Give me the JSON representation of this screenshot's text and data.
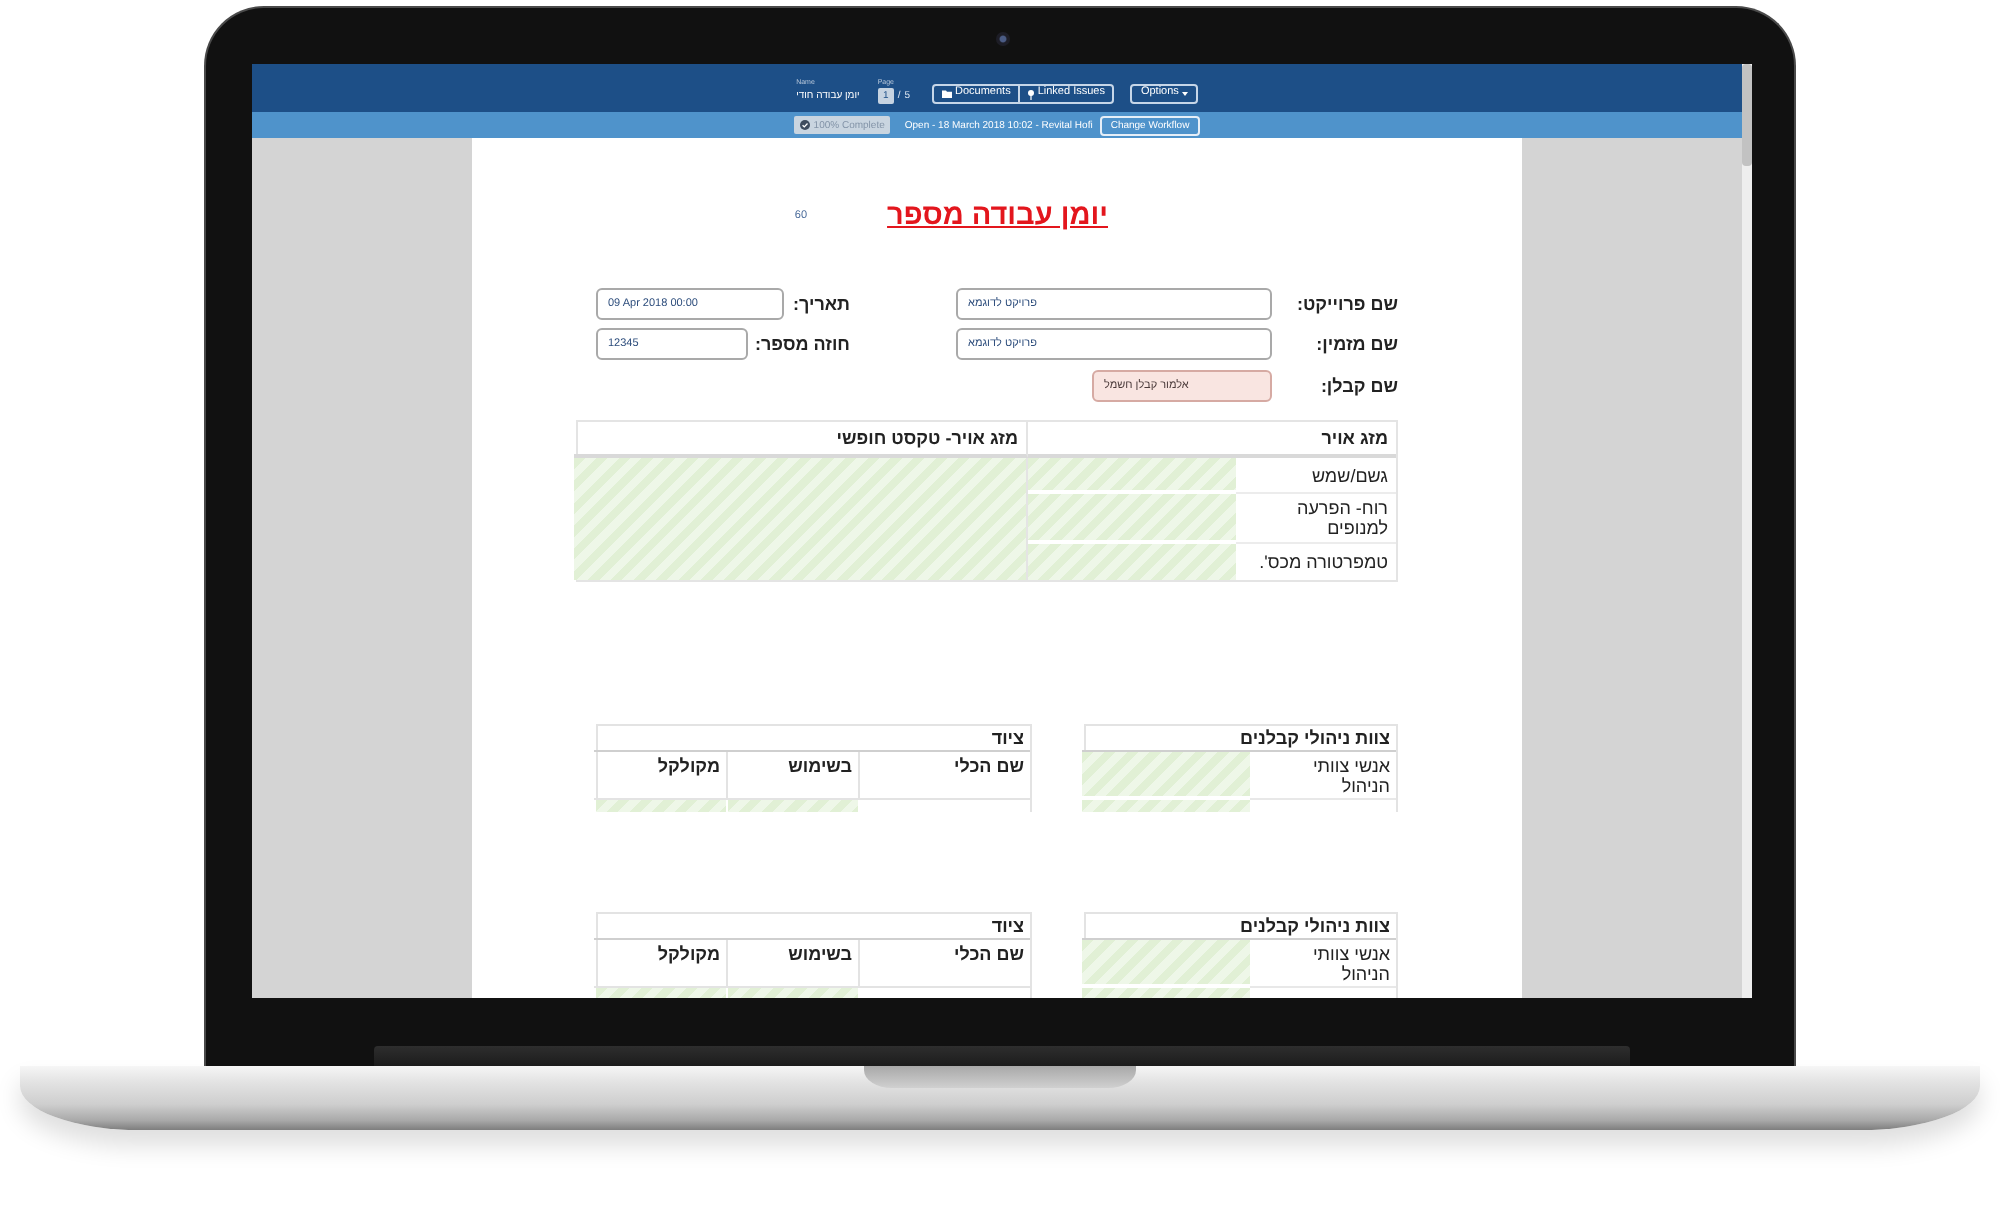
{
  "toolbar": {
    "name_label": "Name",
    "name_value": "יומן עבודה חודי",
    "page_label": "Page",
    "page_current": "1",
    "page_separator": "/",
    "page_total": "5",
    "documents_button": "Documents",
    "linked_issues_button": "Linked Issues",
    "options_button": "Options"
  },
  "status_bar": {
    "progress": "100% Complete",
    "info": "Open - 18 March 2018 10:02 - Revital Hofi",
    "workflow_button": "Change Workflow"
  },
  "document": {
    "number": "60",
    "title": "יומן עבודה מספר",
    "fields": [
      {
        "label": "שם פרוייקט:",
        "value": "פרויקט לדוגמא",
        "kind": "text"
      },
      {
        "label": "שם מזמין:",
        "value": "פרויקט לדוגמא",
        "kind": "text"
      },
      {
        "label": "שם קבלן:",
        "value": "אלמור קבלן חשמל",
        "kind": "marked"
      }
    ],
    "side_fields": [
      {
        "label": "תאריך:",
        "value": "09 Apr 2018 00:00"
      },
      {
        "label": "חוזה מספר:",
        "value": "12345"
      }
    ],
    "weather_table": {
      "columns": [
        "מזג אויר",
        "מזג אויר- טקסט חופשי"
      ],
      "rows": [
        "גשם/שמש",
        "רוח- הפרעה למנופים",
        "טמפרטורה מכס'."
      ]
    },
    "sections": [
      {
        "equipment": {
          "title": "ציוד",
          "columns": [
            "שם הכלי",
            "בשימוש",
            "מקולקל"
          ]
        },
        "team": {
          "title": "צוות ניהולי קבלנים",
          "rows": [
            "אנשי צוותי הניהול"
          ]
        }
      },
      {
        "equipment": {
          "title": "ציוד",
          "columns": [
            "שם הכלי",
            "בשימוש",
            "מקולקל"
          ]
        },
        "team": {
          "title": "צוות ניהולי קבלנים",
          "rows": [
            "אנשי צוותי הניהול"
          ]
        }
      }
    ]
  }
}
